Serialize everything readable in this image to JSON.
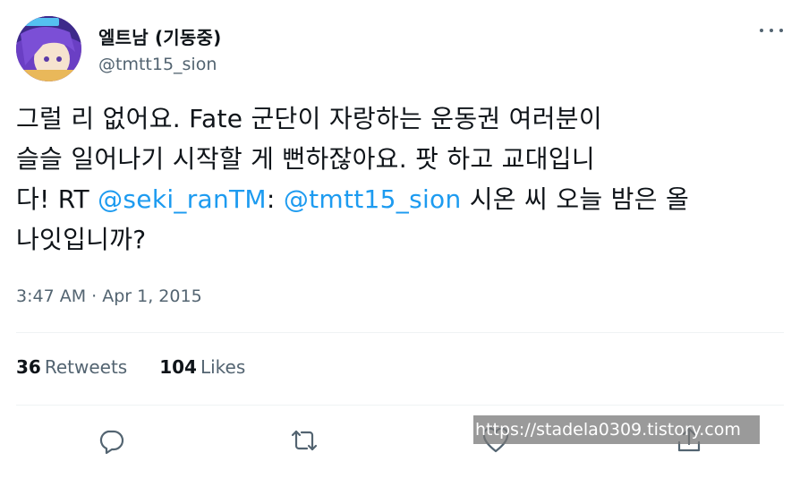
{
  "user": {
    "display_name": "엘트남 (기동중)",
    "handle": "@tmtt15_sion"
  },
  "tweet": {
    "line1": "그럴 리 없어요. Fate 군단이 자랑하는 운동권 여러분이",
    "line2": "슬슬 일어나기 시작할 게 뻔하잖아요. 팟 하고 교대입니",
    "line3_prefix": "다! RT ",
    "mention1": "@seki_ranTM",
    "line3_colon": ": ",
    "mention2": "@tmtt15_sion",
    "line3_suffix": " 시온 씨 오늘 밤은 올",
    "line4": "나잇입니까?"
  },
  "meta": {
    "time": "3:47 AM",
    "separator": " · ",
    "date": "Apr 1, 2015"
  },
  "stats": {
    "retweets_count": "36",
    "retweets_label": "Retweets",
    "likes_count": "104",
    "likes_label": "Likes"
  },
  "actions": {
    "icons": [
      "reply-icon",
      "retweet-icon",
      "like-icon",
      "share-icon"
    ]
  },
  "watermark": "https://stadela0309.tistory.com",
  "colors": {
    "text": "#0f1419",
    "secondary": "#536471",
    "link": "#1d9bf0",
    "divider": "#eff3f4"
  }
}
